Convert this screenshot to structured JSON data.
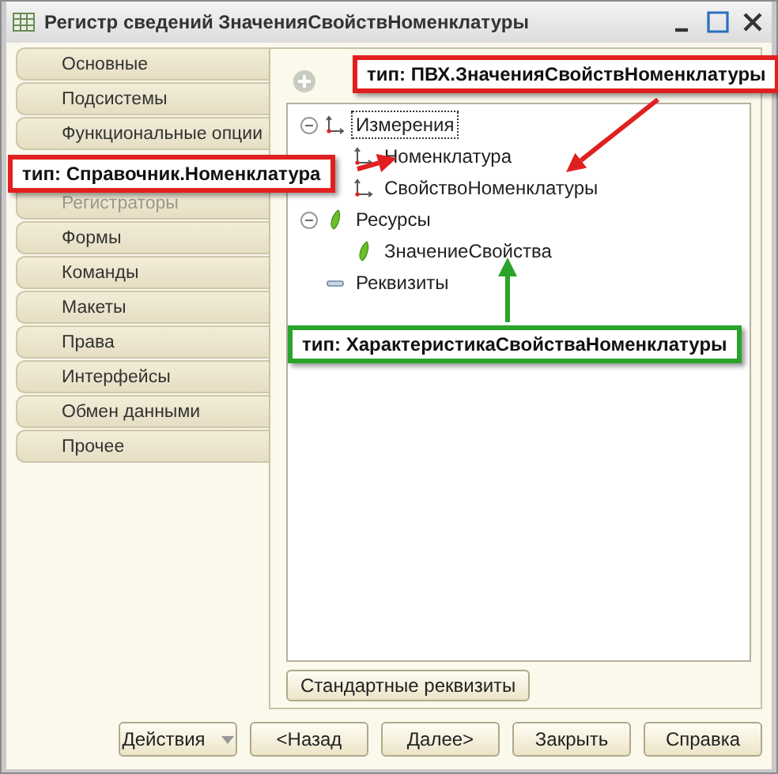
{
  "window": {
    "title": "Регистр сведений ЗначенияСвойствНоменклатуры"
  },
  "tabs_above_callout": [
    {
      "label": "Основные",
      "disabled": false
    },
    {
      "label": "Подсистемы",
      "disabled": false
    },
    {
      "label": "Функциональные опции",
      "disabled": false
    }
  ],
  "tabs_below_callout": [
    {
      "label": "Регистраторы",
      "disabled": true
    },
    {
      "label": "Формы",
      "disabled": false
    },
    {
      "label": "Команды",
      "disabled": false
    },
    {
      "label": "Макеты",
      "disabled": false
    },
    {
      "label": "Права",
      "disabled": false
    },
    {
      "label": "Интерфейсы",
      "disabled": false
    },
    {
      "label": "Обмен данными",
      "disabled": false
    },
    {
      "label": "Прочее",
      "disabled": false
    }
  ],
  "tree": [
    {
      "label": "Измерения",
      "kind": "dimension",
      "expanded": true,
      "focused": true,
      "children": [
        {
          "label": "Номенклатура",
          "kind": "dimension",
          "focused": false
        },
        {
          "label": "СвойствоНоменклатуры",
          "kind": "dimension",
          "focused": false
        }
      ]
    },
    {
      "label": "Ресурсы",
      "kind": "resource",
      "expanded": true,
      "focused": false,
      "children": [
        {
          "label": "ЗначениеСвойства",
          "kind": "resource",
          "focused": false
        }
      ]
    },
    {
      "label": "Реквизиты",
      "kind": "attribute",
      "focused": false
    }
  ],
  "standard_button": "Стандартные реквизиты",
  "footer_buttons": [
    {
      "label": "Действия",
      "kind": "dropdown"
    },
    {
      "label": "<Назад",
      "kind": "plain"
    },
    {
      "label": "Далее>",
      "kind": "plain"
    },
    {
      "label": "Закрыть",
      "kind": "plain"
    },
    {
      "label": "Справка",
      "kind": "plain"
    }
  ],
  "callouts": [
    {
      "text": "тип: ПВХ.ЗначенияСвойствНоменклатуры",
      "color": "#e02020"
    },
    {
      "text": "тип: Справочник.Номенклатура",
      "color": "#e02020"
    },
    {
      "text": "тип: ХарактеристикаСвойстваНоменклатуры",
      "color": "#2aa32a"
    }
  ]
}
